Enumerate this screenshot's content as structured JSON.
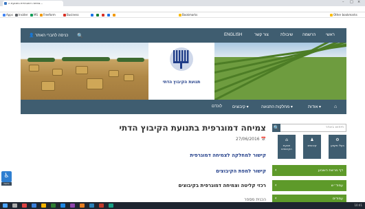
{
  "browser": {
    "tab_title": "צמיחה דמוגרפית בתנועת ה...",
    "url": "kdati.org.il/he/event/Item/0177",
    "window_controls": [
      "–",
      "□",
      "×"
    ],
    "nav_icons": [
      "back-icon",
      "forward-icon",
      "reload-icon",
      "home-icon"
    ],
    "bookmarks": [
      "Apps",
      "Insider",
      "MS",
      "Freeform",
      "Business",
      "",
      "",
      "",
      "",
      "",
      "Bookmarks",
      "Other bookmarks"
    ],
    "colors": {
      "tabbar": "#dee1e6"
    }
  },
  "header": {
    "login_label": "כניסה לחברי האתר",
    "search_icon": "search-icon",
    "nav": [
      "ראשי",
      "הרשמה",
      "שיבולת",
      "צור קשר",
      "ENGLISH"
    ],
    "colors": {
      "bar": "#3f5d70"
    }
  },
  "banner": {
    "logo_text": "תנועת הקיבוץ הדתי"
  },
  "menu": {
    "home_icon": "home-icon",
    "items": [
      "אודות",
      "מחלקות התנועה",
      "קיבוצים",
      "לוכדם"
    ]
  },
  "article": {
    "title": "צמיחה דמוגרפית בתנועת הקיבוץ הדתי",
    "date": "27/06/2016",
    "link1": "קישור למחלקה לצמיחה דמוגרפית",
    "link2": "קישור למפת הקיבוצים",
    "subtitle": "רכזי קליטה וצמיחה דמוגרפית בקיבוצים",
    "cut_text": "הכנית מספר"
  },
  "sidebar": {
    "search_placeholder": "חיפוש באתר",
    "tiles": [
      {
        "icon": "gear-icon",
        "label": "בעלי מקצע"
      },
      {
        "icon": "user-icon",
        "label": "קיבוצים"
      },
      {
        "icon": "home-icon",
        "label": "תנועת הקיבוצים"
      }
    ],
    "bars": [
      "דף מרשת השבוע",
      "עמוד״ש",
      "עמודים"
    ],
    "colors": {
      "bar": "#5e9a2a"
    }
  },
  "accessibility": {
    "label": "נגישות"
  },
  "taskbar": {
    "clock": "10:41"
  }
}
